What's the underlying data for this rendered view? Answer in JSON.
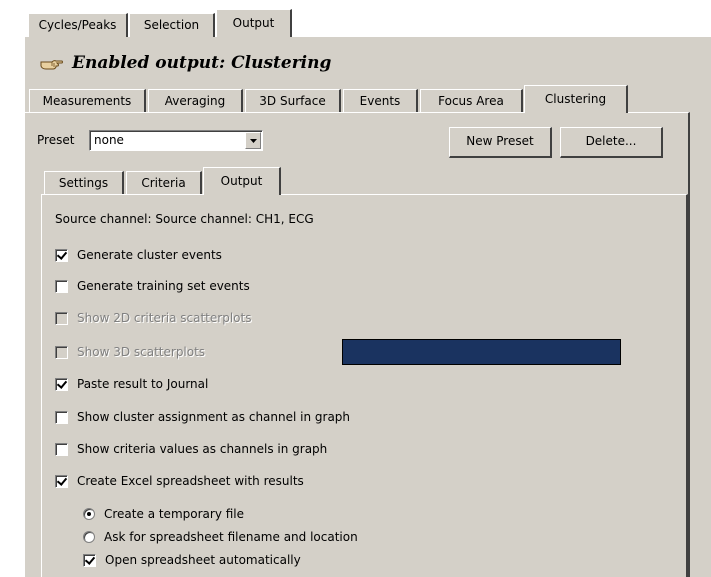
{
  "top_tabs": [
    "Cycles/Peaks",
    "Selection",
    "Output"
  ],
  "top_tab_selected": "Output",
  "header": {
    "title": "Enabled output: Clustering",
    "icon": "hand-pointer-icon"
  },
  "sub_tabs": [
    "Measurements",
    "Averaging",
    "3D Surface",
    "Events",
    "Focus Area",
    "Clustering"
  ],
  "sub_tab_selected": "Clustering",
  "preset": {
    "label": "Preset",
    "value": "none",
    "new_button": "New Preset",
    "delete_button": "Delete..."
  },
  "inner_tabs": [
    "Settings",
    "Criteria",
    "Output"
  ],
  "inner_tab_selected": "Output",
  "source_channel": "Source channel: Source channel: CH1, ECG",
  "options": [
    {
      "label": "Generate cluster events",
      "checked": true,
      "disabled": false
    },
    {
      "label": "Generate training set events",
      "checked": false,
      "disabled": false
    },
    {
      "label": "Show 2D criteria scatterplots",
      "checked": false,
      "disabled": true
    },
    {
      "label": "Show 3D scatterplots",
      "checked": false,
      "disabled": true
    },
    {
      "label": "Paste result to Journal",
      "checked": true,
      "disabled": false
    },
    {
      "label": "Show cluster assignment as channel in graph",
      "checked": false,
      "disabled": false
    },
    {
      "label": "Show criteria values as channels in graph",
      "checked": false,
      "disabled": false
    },
    {
      "label": "Create Excel spreadsheet with results",
      "checked": true,
      "disabled": false
    }
  ],
  "spreadsheet": {
    "radio_temp": "Create a temporary file",
    "radio_ask": "Ask for spreadsheet filename and location",
    "radio_selected": "Create a temporary file",
    "open_auto": "Open spreadsheet automatically",
    "open_auto_checked": true
  },
  "colors": {
    "face": "#d4d0c8",
    "highlight_bar": "#1a3360"
  }
}
